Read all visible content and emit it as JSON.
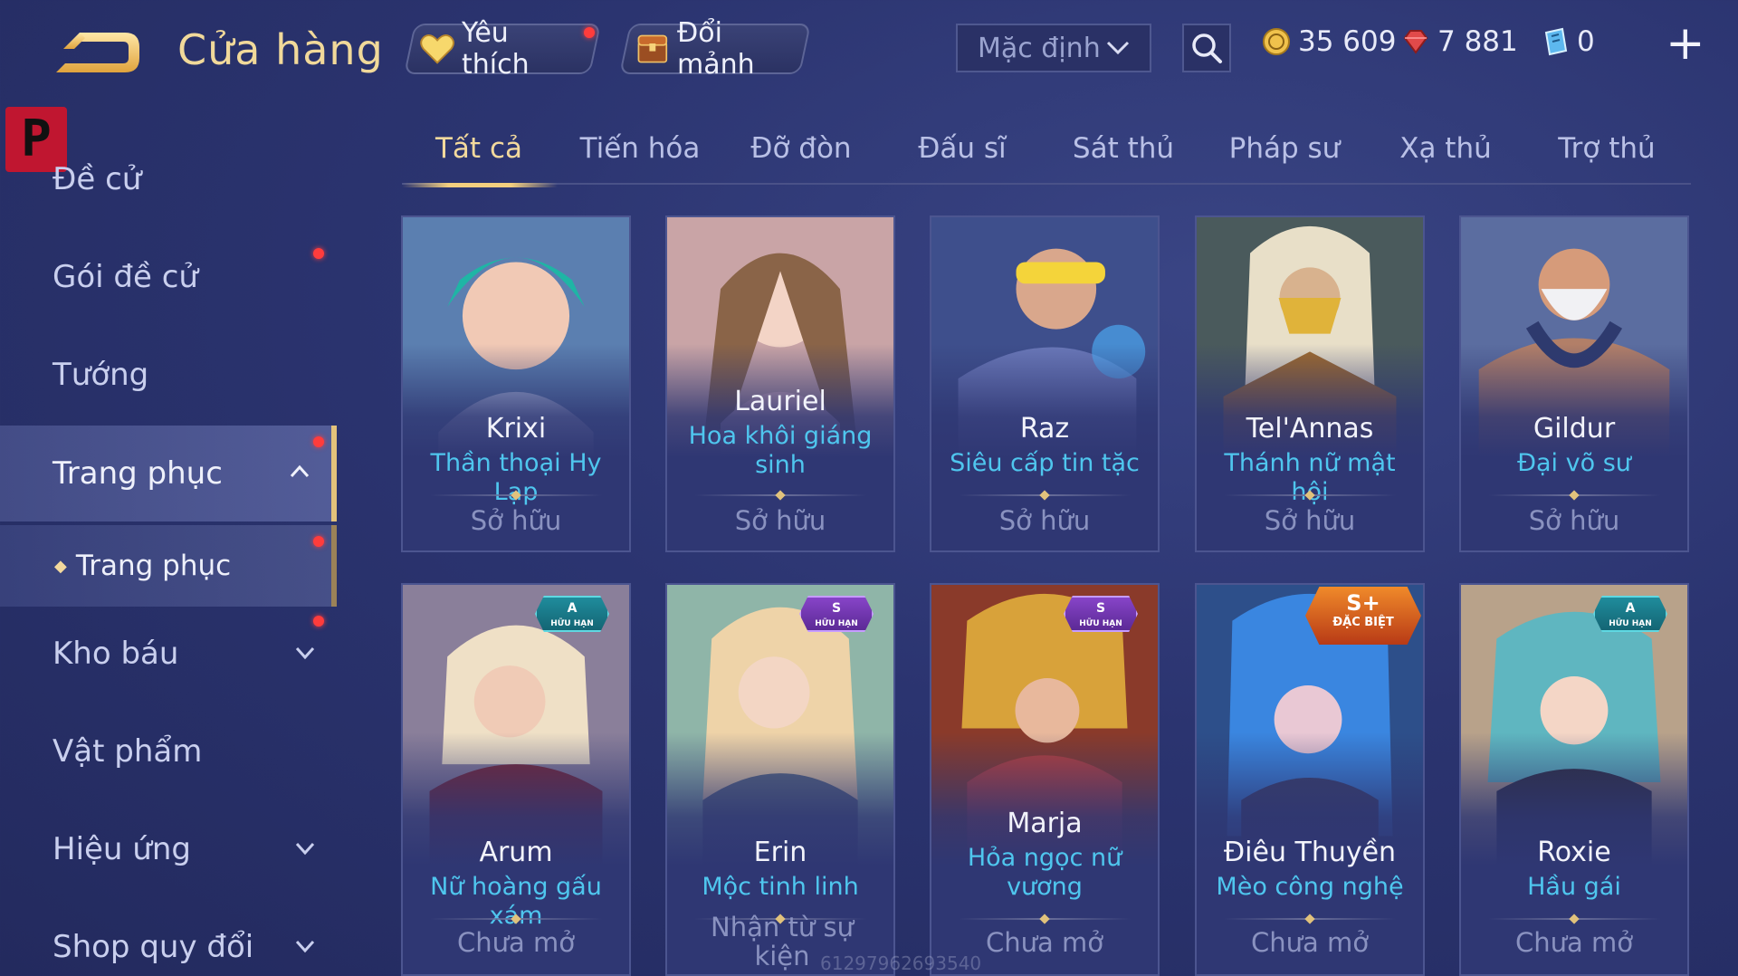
{
  "header": {
    "title": "Cửa hàng",
    "favorites_label": "Yêu thích",
    "fragments_label": "Đổi mảnh",
    "sort_selected": "Mặc định",
    "currency": [
      {
        "icon": "gold-coin-icon",
        "value": "35 609"
      },
      {
        "icon": "red-gem-icon",
        "value": "7 881"
      },
      {
        "icon": "blue-voucher-icon",
        "value": "0"
      }
    ]
  },
  "logo_letter": "P",
  "sidebar": {
    "items": [
      {
        "label": "Đề cử"
      },
      {
        "label": "Gói đề cử"
      },
      {
        "label": "Tướng"
      },
      {
        "label": "Trang phục"
      },
      {
        "label": "Trang phục"
      },
      {
        "label": "Kho báu"
      },
      {
        "label": "Vật phẩm"
      },
      {
        "label": "Hiệu ứng"
      },
      {
        "label": "Shop quy đổi"
      }
    ]
  },
  "tabs": [
    "Tất cả",
    "Tiến hóa",
    "Đỡ đòn",
    "Đấu sĩ",
    "Sát thủ",
    "Pháp sư",
    "Xạ thủ",
    "Trợ thủ"
  ],
  "cards": [
    {
      "name": "Krixi",
      "skin": "Thần thoại Hy Lạp",
      "status": "Sở hữu",
      "badge": "",
      "badge_sub": ""
    },
    {
      "name": "Lauriel",
      "skin": "Hoa khôi giáng sinh",
      "status": "Sở hữu",
      "badge": "",
      "badge_sub": ""
    },
    {
      "name": "Raz",
      "skin": "Siêu cấp tin tặc",
      "status": "Sở hữu",
      "badge": "",
      "badge_sub": ""
    },
    {
      "name": "Tel'Annas",
      "skin": "Thánh nữ mật hội",
      "status": "Sở hữu",
      "badge": "",
      "badge_sub": ""
    },
    {
      "name": "Gildur",
      "skin": "Đại võ sư",
      "status": "Sở hữu",
      "badge": "",
      "badge_sub": ""
    },
    {
      "name": "Arum",
      "skin": "Nữ hoàng gấu xám",
      "status": "Chưa mở",
      "badge": "A",
      "badge_sub": "HỮU HẠN"
    },
    {
      "name": "Erin",
      "skin": "Mộc tinh linh",
      "status": "Nhận từ sự kiện",
      "badge": "S",
      "badge_sub": "HỮU HẠN"
    },
    {
      "name": "Marja",
      "skin": "Hỏa ngọc nữ vương",
      "status": "Chưa mở",
      "badge": "S",
      "badge_sub": "HỮU HẠN"
    },
    {
      "name": "Điêu Thuyền",
      "skin": "Mèo công nghệ",
      "status": "Chưa mở",
      "badge": "S+",
      "badge_sub": "ĐẶC BIỆT"
    },
    {
      "name": "Roxie",
      "skin": "Hầu gái",
      "status": "Chưa mở",
      "badge": "A",
      "badge_sub": "HỮU HẠN"
    }
  ],
  "watermark": "61297962693540",
  "colors": {
    "accent_gold": "#f3d99d",
    "skin_blue": "#4fc6ee",
    "notify_red": "#ff3c3c"
  }
}
